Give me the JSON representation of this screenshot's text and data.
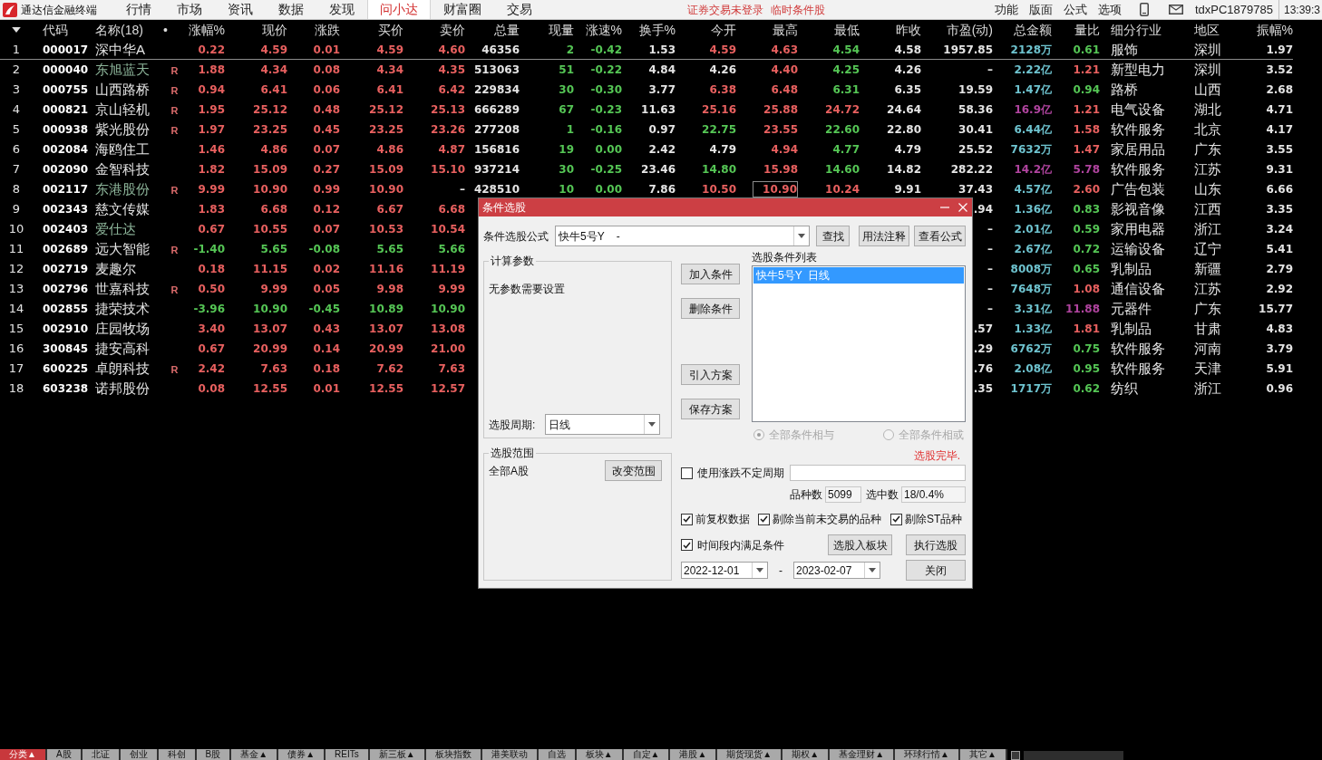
{
  "menu_bar": {
    "app_title": "通达信金融终端",
    "tabs": [
      {
        "label": "行情",
        "selected": false
      },
      {
        "label": "市场",
        "selected": false
      },
      {
        "label": "资讯",
        "selected": false
      },
      {
        "label": "数据",
        "selected": false
      },
      {
        "label": "发现",
        "selected": false
      },
      {
        "label": "问小达",
        "selected": true
      },
      {
        "label": "财富圈",
        "selected": false
      },
      {
        "label": "交易",
        "selected": false
      }
    ],
    "notices": [
      "证券交易未登录",
      "临时条件股"
    ],
    "tools": [
      "功能",
      "版面",
      "公式",
      "选项"
    ],
    "user": "tdxPC1879785",
    "time": "13:39:3"
  },
  "table": {
    "columns": [
      "代码",
      "名称(18)",
      "•",
      "涨幅%",
      "现价",
      "涨跌",
      "买价",
      "卖价",
      "总量",
      "现量",
      "涨速%",
      "换手%",
      "今开",
      "最高",
      "最低",
      "昨收",
      "市盈(动)",
      "总金额",
      "量比",
      "细分行业",
      "地区",
      "振幅%"
    ],
    "rows": [
      {
        "selected": true,
        "index": "1",
        "code": "000017",
        "name": {
          "text": "深中华A",
          "color": "#e4e4e4"
        },
        "quote": [
          {
            "text": "0.22",
            "color": "#e8605f"
          },
          {
            "text": "4.59",
            "color": "#e8605f"
          },
          {
            "text": "0.01",
            "color": "#e8605f"
          },
          {
            "text": "4.59",
            "color": "#e8605f"
          },
          {
            "text": "4.60",
            "color": "#e8605f"
          }
        ],
        "volume": [
          {
            "text": "46356"
          },
          {
            "text": "2",
            "color": "#55c655"
          },
          {
            "text": "-0.42",
            "color": "#55c655"
          },
          {
            "text": "1.53"
          },
          {
            "text": "4.59",
            "color": "#e8605f"
          },
          {
            "text": "4.63",
            "color": "#e8605f"
          },
          {
            "text": "4.54",
            "color": "#55c655"
          },
          {
            "text": "4.58"
          }
        ],
        "profile": [
          {
            "text": "1957.85"
          },
          {
            "text": "2128万",
            "color": "#6ec3cf"
          },
          {
            "text": "0.61",
            "color": "#55c655"
          },
          {
            "text": "服饰"
          },
          {
            "text": "深圳"
          },
          {
            "text": "1.97"
          }
        ]
      },
      {
        "selected": false,
        "index": "2",
        "code": "000040",
        "name": {
          "text": "东旭蓝天",
          "color": "#8db59a"
        },
        "flag": "R",
        "quote": [
          {
            "text": "1.88",
            "color": "#e8605f"
          },
          {
            "text": "4.34",
            "color": "#e8605f"
          },
          {
            "text": "0.08",
            "color": "#e8605f"
          },
          {
            "text": "4.34",
            "color": "#e8605f"
          },
          {
            "text": "4.35",
            "color": "#e8605f"
          }
        ],
        "volume": [
          {
            "text": "513063"
          },
          {
            "text": "51",
            "color": "#55c655"
          },
          {
            "text": "-0.22",
            "color": "#55c655"
          },
          {
            "text": "4.84"
          },
          {
            "text": "4.26",
            "color": "#e4e4e4"
          },
          {
            "text": "4.40",
            "color": "#e8605f"
          },
          {
            "text": "4.25",
            "color": "#55c655"
          },
          {
            "text": "4.26"
          }
        ],
        "profile": [
          {
            "text": "–"
          },
          {
            "text": "2.22亿",
            "color": "#6ec3cf"
          },
          {
            "text": "1.21",
            "color": "#e8605f"
          },
          {
            "text": "新型电力"
          },
          {
            "text": "深圳"
          },
          {
            "text": "3.52"
          }
        ]
      },
      {
        "selected": false,
        "index": "3",
        "code": "000755",
        "name": {
          "text": "山西路桥",
          "color": "#e4e4e4"
        },
        "flag": "R",
        "quote": [
          {
            "text": "0.94",
            "color": "#e8605f"
          },
          {
            "text": "6.41",
            "color": "#e8605f"
          },
          {
            "text": "0.06",
            "color": "#e8605f"
          },
          {
            "text": "6.41",
            "color": "#e8605f"
          },
          {
            "text": "6.42",
            "color": "#e8605f"
          }
        ],
        "volume": [
          {
            "text": "229834"
          },
          {
            "text": "30",
            "color": "#55c655"
          },
          {
            "text": "-0.30",
            "color": "#55c655"
          },
          {
            "text": "3.77"
          },
          {
            "text": "6.38",
            "color": "#e8605f"
          },
          {
            "text": "6.48",
            "color": "#e8605f"
          },
          {
            "text": "6.31",
            "color": "#55c655"
          },
          {
            "text": "6.35"
          }
        ],
        "profile": [
          {
            "text": "19.59"
          },
          {
            "text": "1.47亿",
            "color": "#6ec3cf"
          },
          {
            "text": "0.94",
            "color": "#55c655"
          },
          {
            "text": "路桥"
          },
          {
            "text": "山西"
          },
          {
            "text": "2.68"
          }
        ]
      },
      {
        "selected": false,
        "index": "4",
        "code": "000821",
        "name": {
          "text": "京山轻机",
          "color": "#e4e4e4"
        },
        "flag": "R",
        "quote": [
          {
            "text": "1.95",
            "color": "#e8605f"
          },
          {
            "text": "25.12",
            "color": "#e8605f"
          },
          {
            "text": "0.48",
            "color": "#e8605f"
          },
          {
            "text": "25.12",
            "color": "#e8605f"
          },
          {
            "text": "25.13",
            "color": "#e8605f"
          }
        ],
        "volume": [
          {
            "text": "666289"
          },
          {
            "text": "67",
            "color": "#55c655"
          },
          {
            "text": "-0.23",
            "color": "#55c655"
          },
          {
            "text": "11.63"
          },
          {
            "text": "25.16",
            "color": "#e8605f"
          },
          {
            "text": "25.88",
            "color": "#e8605f"
          },
          {
            "text": "24.72",
            "color": "#e8605f"
          },
          {
            "text": "24.64"
          }
        ],
        "profile": [
          {
            "text": "58.36"
          },
          {
            "text": "16.9亿",
            "color": "#b0449f"
          },
          {
            "text": "1.21",
            "color": "#e8605f"
          },
          {
            "text": "电气设备"
          },
          {
            "text": "湖北"
          },
          {
            "text": "4.71"
          }
        ]
      },
      {
        "selected": false,
        "index": "5",
        "code": "000938",
        "name": {
          "text": "紫光股份",
          "color": "#e4e4e4"
        },
        "flag": "R",
        "quote": [
          {
            "text": "1.97",
            "color": "#e8605f"
          },
          {
            "text": "23.25",
            "color": "#e8605f"
          },
          {
            "text": "0.45",
            "color": "#e8605f"
          },
          {
            "text": "23.25",
            "color": "#e8605f"
          },
          {
            "text": "23.26",
            "color": "#e8605f"
          }
        ],
        "volume": [
          {
            "text": "277208"
          },
          {
            "text": "1",
            "color": "#55c655"
          },
          {
            "text": "-0.16",
            "color": "#55c655"
          },
          {
            "text": "0.97"
          },
          {
            "text": "22.75",
            "color": "#55c655"
          },
          {
            "text": "23.55",
            "color": "#e8605f"
          },
          {
            "text": "22.60",
            "color": "#55c655"
          },
          {
            "text": "22.80"
          }
        ],
        "profile": [
          {
            "text": "30.41"
          },
          {
            "text": "6.44亿",
            "color": "#6ec3cf"
          },
          {
            "text": "1.58",
            "color": "#e8605f"
          },
          {
            "text": "软件服务"
          },
          {
            "text": "北京"
          },
          {
            "text": "4.17"
          }
        ]
      },
      {
        "selected": false,
        "index": "6",
        "code": "002084",
        "name": {
          "text": "海鸥住工",
          "color": "#e4e4e4"
        },
        "quote": [
          {
            "text": "1.46",
            "color": "#e8605f"
          },
          {
            "text": "4.86",
            "color": "#e8605f"
          },
          {
            "text": "0.07",
            "color": "#e8605f"
          },
          {
            "text": "4.86",
            "color": "#e8605f"
          },
          {
            "text": "4.87",
            "color": "#e8605f"
          }
        ],
        "volume": [
          {
            "text": "156816"
          },
          {
            "text": "19",
            "color": "#55c655"
          },
          {
            "text": "0.00",
            "color": "#55c655"
          },
          {
            "text": "2.42"
          },
          {
            "text": "4.79",
            "color": "#e4e4e4"
          },
          {
            "text": "4.94",
            "color": "#e8605f"
          },
          {
            "text": "4.77",
            "color": "#55c655"
          },
          {
            "text": "4.79"
          }
        ],
        "profile": [
          {
            "text": "25.52"
          },
          {
            "text": "7632万",
            "color": "#6ec3cf"
          },
          {
            "text": "1.47",
            "color": "#e8605f"
          },
          {
            "text": "家居用品"
          },
          {
            "text": "广东"
          },
          {
            "text": "3.55"
          }
        ]
      },
      {
        "selected": false,
        "index": "7",
        "code": "002090",
        "name": {
          "text": "金智科技",
          "color": "#e4e4e4"
        },
        "quote": [
          {
            "text": "1.82",
            "color": "#e8605f"
          },
          {
            "text": "15.09",
            "color": "#e8605f"
          },
          {
            "text": "0.27",
            "color": "#e8605f"
          },
          {
            "text": "15.09",
            "color": "#e8605f"
          },
          {
            "text": "15.10",
            "color": "#e8605f"
          }
        ],
        "volume": [
          {
            "text": "937214"
          },
          {
            "text": "30",
            "color": "#55c655"
          },
          {
            "text": "-0.25",
            "color": "#55c655"
          },
          {
            "text": "23.46"
          },
          {
            "text": "14.80",
            "color": "#55c655"
          },
          {
            "text": "15.98",
            "color": "#e8605f"
          },
          {
            "text": "14.60",
            "color": "#55c655"
          },
          {
            "text": "14.82"
          }
        ],
        "profile": [
          {
            "text": "282.22"
          },
          {
            "text": "14.2亿",
            "color": "#b0449f"
          },
          {
            "text": "5.78",
            "color": "#b0449f"
          },
          {
            "text": "软件服务"
          },
          {
            "text": "江苏"
          },
          {
            "text": "9.31"
          }
        ]
      },
      {
        "selected": false,
        "index": "8",
        "code": "002117",
        "name": {
          "text": "东港股份",
          "color": "#8db59a"
        },
        "flag": "R",
        "quote": [
          {
            "text": "9.99",
            "color": "#e8605f"
          },
          {
            "text": "10.90",
            "color": "#e8605f"
          },
          {
            "text": "0.99",
            "color": "#e8605f"
          },
          {
            "text": "10.90",
            "color": "#e8605f"
          },
          {
            "text": "–",
            "color": "#e4e4e4"
          }
        ],
        "volume": [
          {
            "text": "428510"
          },
          {
            "text": "10",
            "color": "#55c655"
          },
          {
            "text": "0.00",
            "color": "#55c655"
          },
          {
            "text": "7.86"
          },
          {
            "text": "10.50",
            "color": "#e8605f"
          },
          {
            "text": "10.90",
            "color": "#e8605f",
            "boxed": true
          },
          {
            "text": "10.24",
            "color": "#e8605f"
          },
          {
            "text": "9.91"
          }
        ],
        "profile": [
          {
            "text": "37.43"
          },
          {
            "text": "4.57亿",
            "color": "#6ec3cf"
          },
          {
            "text": "2.60",
            "color": "#e8605f"
          },
          {
            "text": "广告包装"
          },
          {
            "text": "山东"
          },
          {
            "text": "6.66"
          }
        ]
      },
      {
        "selected": false,
        "index": "9",
        "code": "002343",
        "name": {
          "text": "慈文传媒",
          "color": "#e4e4e4"
        },
        "quote": [
          {
            "text": "1.83",
            "color": "#e8605f"
          },
          {
            "text": "6.68",
            "color": "#e8605f"
          },
          {
            "text": "0.12",
            "color": "#e8605f"
          },
          {
            "text": "6.67",
            "color": "#e8605f"
          },
          {
            "text": "6.68",
            "color": "#e8605f"
          }
        ],
        "profile": [
          {
            "text": ".94"
          },
          {
            "text": "1.36亿",
            "color": "#6ec3cf"
          },
          {
            "text": "0.83",
            "color": "#55c655"
          },
          {
            "text": "影视音像"
          },
          {
            "text": "江西"
          },
          {
            "text": "3.35"
          }
        ]
      },
      {
        "selected": false,
        "index": "10",
        "code": "002403",
        "name": {
          "text": "爱仕达",
          "color": "#8db59a"
        },
        "quote": [
          {
            "text": "0.67",
            "color": "#e8605f"
          },
          {
            "text": "10.55",
            "color": "#e8605f"
          },
          {
            "text": "0.07",
            "color": "#e8605f"
          },
          {
            "text": "10.53",
            "color": "#e8605f"
          },
          {
            "text": "10.54",
            "color": "#e8605f"
          }
        ],
        "profile": [
          {
            "text": "–"
          },
          {
            "text": "2.01亿",
            "color": "#6ec3cf"
          },
          {
            "text": "0.59",
            "color": "#55c655"
          },
          {
            "text": "家用电器"
          },
          {
            "text": "浙江"
          },
          {
            "text": "3.24"
          }
        ]
      },
      {
        "selected": false,
        "index": "11",
        "code": "002689",
        "name": {
          "text": "远大智能",
          "color": "#e4e4e4"
        },
        "flag": "R",
        "quote": [
          {
            "text": "-1.40",
            "color": "#55c655"
          },
          {
            "text": "5.65",
            "color": "#55c655"
          },
          {
            "text": "-0.08",
            "color": "#55c655"
          },
          {
            "text": "5.65",
            "color": "#55c655"
          },
          {
            "text": "5.66",
            "color": "#55c655"
          }
        ],
        "profile": [
          {
            "text": "–"
          },
          {
            "text": "2.67亿",
            "color": "#6ec3cf"
          },
          {
            "text": "0.72",
            "color": "#55c655"
          },
          {
            "text": "运输设备"
          },
          {
            "text": "辽宁"
          },
          {
            "text": "5.41"
          }
        ]
      },
      {
        "selected": false,
        "index": "12",
        "code": "002719",
        "name": {
          "text": "麦趣尔",
          "color": "#e4e4e4"
        },
        "quote": [
          {
            "text": "0.18",
            "color": "#e8605f"
          },
          {
            "text": "11.15",
            "color": "#e8605f"
          },
          {
            "text": "0.02",
            "color": "#e8605f"
          },
          {
            "text": "11.16",
            "color": "#e8605f"
          },
          {
            "text": "11.19",
            "color": "#e8605f"
          }
        ],
        "profile": [
          {
            "text": "–"
          },
          {
            "text": "8008万",
            "color": "#6ec3cf"
          },
          {
            "text": "0.65",
            "color": "#55c655"
          },
          {
            "text": "乳制品"
          },
          {
            "text": "新疆"
          },
          {
            "text": "2.79"
          }
        ]
      },
      {
        "selected": false,
        "index": "13",
        "code": "002796",
        "name": {
          "text": "世嘉科技",
          "color": "#e4e4e4"
        },
        "flag": "R",
        "quote": [
          {
            "text": "0.50",
            "color": "#e8605f"
          },
          {
            "text": "9.99",
            "color": "#e8605f"
          },
          {
            "text": "0.05",
            "color": "#e8605f"
          },
          {
            "text": "9.98",
            "color": "#e8605f"
          },
          {
            "text": "9.99",
            "color": "#e8605f"
          }
        ],
        "profile": [
          {
            "text": "–"
          },
          {
            "text": "7648万",
            "color": "#6ec3cf"
          },
          {
            "text": "1.08",
            "color": "#e8605f"
          },
          {
            "text": "通信设备"
          },
          {
            "text": "江苏"
          },
          {
            "text": "2.92"
          }
        ]
      },
      {
        "selected": false,
        "index": "14",
        "code": "002855",
        "name": {
          "text": "捷荣技术",
          "color": "#e4e4e4"
        },
        "quote": [
          {
            "text": "-3.96",
            "color": "#55c655"
          },
          {
            "text": "10.90",
            "color": "#55c655"
          },
          {
            "text": "-0.45",
            "color": "#55c655"
          },
          {
            "text": "10.89",
            "color": "#55c655"
          },
          {
            "text": "10.90",
            "color": "#55c655"
          }
        ],
        "profile": [
          {
            "text": "–"
          },
          {
            "text": "3.31亿",
            "color": "#6ec3cf"
          },
          {
            "text": "11.88",
            "color": "#b0449f"
          },
          {
            "text": "元器件"
          },
          {
            "text": "广东"
          },
          {
            "text": "15.77"
          }
        ]
      },
      {
        "selected": false,
        "index": "15",
        "code": "002910",
        "name": {
          "text": "庄园牧场",
          "color": "#e4e4e4"
        },
        "quote": [
          {
            "text": "3.40",
            "color": "#e8605f"
          },
          {
            "text": "13.07",
            "color": "#e8605f"
          },
          {
            "text": "0.43",
            "color": "#e8605f"
          },
          {
            "text": "13.07",
            "color": "#e8605f"
          },
          {
            "text": "13.08",
            "color": "#e8605f"
          }
        ],
        "profile": [
          {
            "text": ".57"
          },
          {
            "text": "1.33亿",
            "color": "#6ec3cf"
          },
          {
            "text": "1.81",
            "color": "#e8605f"
          },
          {
            "text": "乳制品"
          },
          {
            "text": "甘肃"
          },
          {
            "text": "4.83"
          }
        ]
      },
      {
        "selected": false,
        "index": "16",
        "code": "300845",
        "name": {
          "text": "捷安高科",
          "color": "#e4e4e4"
        },
        "quote": [
          {
            "text": "0.67",
            "color": "#e8605f"
          },
          {
            "text": "20.99",
            "color": "#e8605f"
          },
          {
            "text": "0.14",
            "color": "#e8605f"
          },
          {
            "text": "20.99",
            "color": "#e8605f"
          },
          {
            "text": "21.00",
            "color": "#e8605f"
          }
        ],
        "profile": [
          {
            "text": ".29"
          },
          {
            "text": "6762万",
            "color": "#6ec3cf"
          },
          {
            "text": "0.75",
            "color": "#55c655"
          },
          {
            "text": "软件服务"
          },
          {
            "text": "河南"
          },
          {
            "text": "3.79"
          }
        ]
      },
      {
        "selected": false,
        "index": "17",
        "code": "600225",
        "name": {
          "text": "卓朗科技",
          "color": "#e4e4e4"
        },
        "flag": "R",
        "quote": [
          {
            "text": "2.42",
            "color": "#e8605f"
          },
          {
            "text": "7.63",
            "color": "#e8605f"
          },
          {
            "text": "0.18",
            "color": "#e8605f"
          },
          {
            "text": "7.62",
            "color": "#e8605f"
          },
          {
            "text": "7.63",
            "color": "#e8605f"
          }
        ],
        "profile": [
          {
            "text": ".76"
          },
          {
            "text": "2.08亿",
            "color": "#6ec3cf"
          },
          {
            "text": "0.95",
            "color": "#55c655"
          },
          {
            "text": "软件服务"
          },
          {
            "text": "天津"
          },
          {
            "text": "5.91"
          }
        ]
      },
      {
        "selected": false,
        "index": "18",
        "code": "603238",
        "name": {
          "text": "诺邦股份",
          "color": "#e4e4e4"
        },
        "quote": [
          {
            "text": "0.08",
            "color": "#e8605f"
          },
          {
            "text": "12.55",
            "color": "#e8605f"
          },
          {
            "text": "0.01",
            "color": "#e8605f"
          },
          {
            "text": "12.55",
            "color": "#e8605f"
          },
          {
            "text": "12.57",
            "color": "#e8605f"
          }
        ],
        "profile": [
          {
            "text": ".35"
          },
          {
            "text": "1717万",
            "color": "#6ec3cf"
          },
          {
            "text": "0.62",
            "color": "#55c655"
          },
          {
            "text": "纺织"
          },
          {
            "text": "浙江"
          },
          {
            "text": "0.96"
          }
        ]
      }
    ]
  },
  "dialog": {
    "title": "条件选股",
    "formula": {
      "label": "条件选股公式",
      "value": "快牛5号Y    -"
    },
    "top_buttons": [
      "查找",
      "用法注释",
      "查看公式"
    ],
    "params_group": {
      "title": "计算参数",
      "message": "无参数需要设置",
      "period_label": "选股周期:",
      "period_value": "日线"
    },
    "scope_group": {
      "title": "选股范围",
      "value": "全部A股",
      "button": "改变范围"
    },
    "middle_buttons": [
      "加入条件",
      "删除条件",
      "引入方案",
      "保存方案"
    ],
    "condition_list": {
      "label": "选股条件列表",
      "items": [
        {
          "text": "快牛5号Y  日线",
          "selected": true
        }
      ]
    },
    "logic_options": [
      {
        "label": "全部条件相与",
        "selected": true,
        "disabled": true
      },
      {
        "label": "全部条件相或",
        "selected": false,
        "disabled": true
      }
    ],
    "status": "选股完毕.",
    "variable_period": {
      "label": "使用涨跌不定周期",
      "checked": false
    },
    "counts": [
      {
        "label": "品种数",
        "value": "5099"
      },
      {
        "label": "选中数",
        "value": "18/0.4%"
      }
    ],
    "options": [
      {
        "label": "前复权数据",
        "checked": true
      },
      {
        "label": "剔除当前未交易的品种",
        "checked": true
      },
      {
        "label": "剔除ST品种",
        "checked": true
      }
    ],
    "time_filter": {
      "label": "时间段内满足条件",
      "checked": true
    },
    "action_buttons": [
      "选股入板块",
      "执行选股"
    ],
    "date_from": "2022-12-01",
    "date_separator": "-",
    "date_to": "2023-02-07",
    "close_button": "关闭"
  },
  "bottom_tabs": [
    {
      "label": "分类▲",
      "selected": true
    },
    {
      "label": "A股",
      "selected": false
    },
    {
      "label": "北证",
      "selected": false
    },
    {
      "label": "创业",
      "selected": false
    },
    {
      "label": "科创",
      "selected": false
    },
    {
      "label": "B股",
      "selected": false
    },
    {
      "label": "基金▲",
      "selected": false
    },
    {
      "label": "债券▲",
      "selected": false
    },
    {
      "label": "REITs",
      "selected": false
    },
    {
      "label": "新三板▲",
      "selected": false
    },
    {
      "label": "板块指数",
      "selected": false
    },
    {
      "label": "港美联动",
      "selected": false
    },
    {
      "label": "自选",
      "selected": false
    },
    {
      "label": "板块▲",
      "selected": false
    },
    {
      "label": "自定▲",
      "selected": false
    },
    {
      "label": "港股▲",
      "selected": false
    },
    {
      "label": "期货现货▲",
      "selected": false
    },
    {
      "label": "期权▲",
      "selected": false
    },
    {
      "label": "基金理财▲",
      "selected": false
    },
    {
      "label": "环球行情▲",
      "selected": false
    },
    {
      "label": "其它▲",
      "selected": false
    }
  ]
}
